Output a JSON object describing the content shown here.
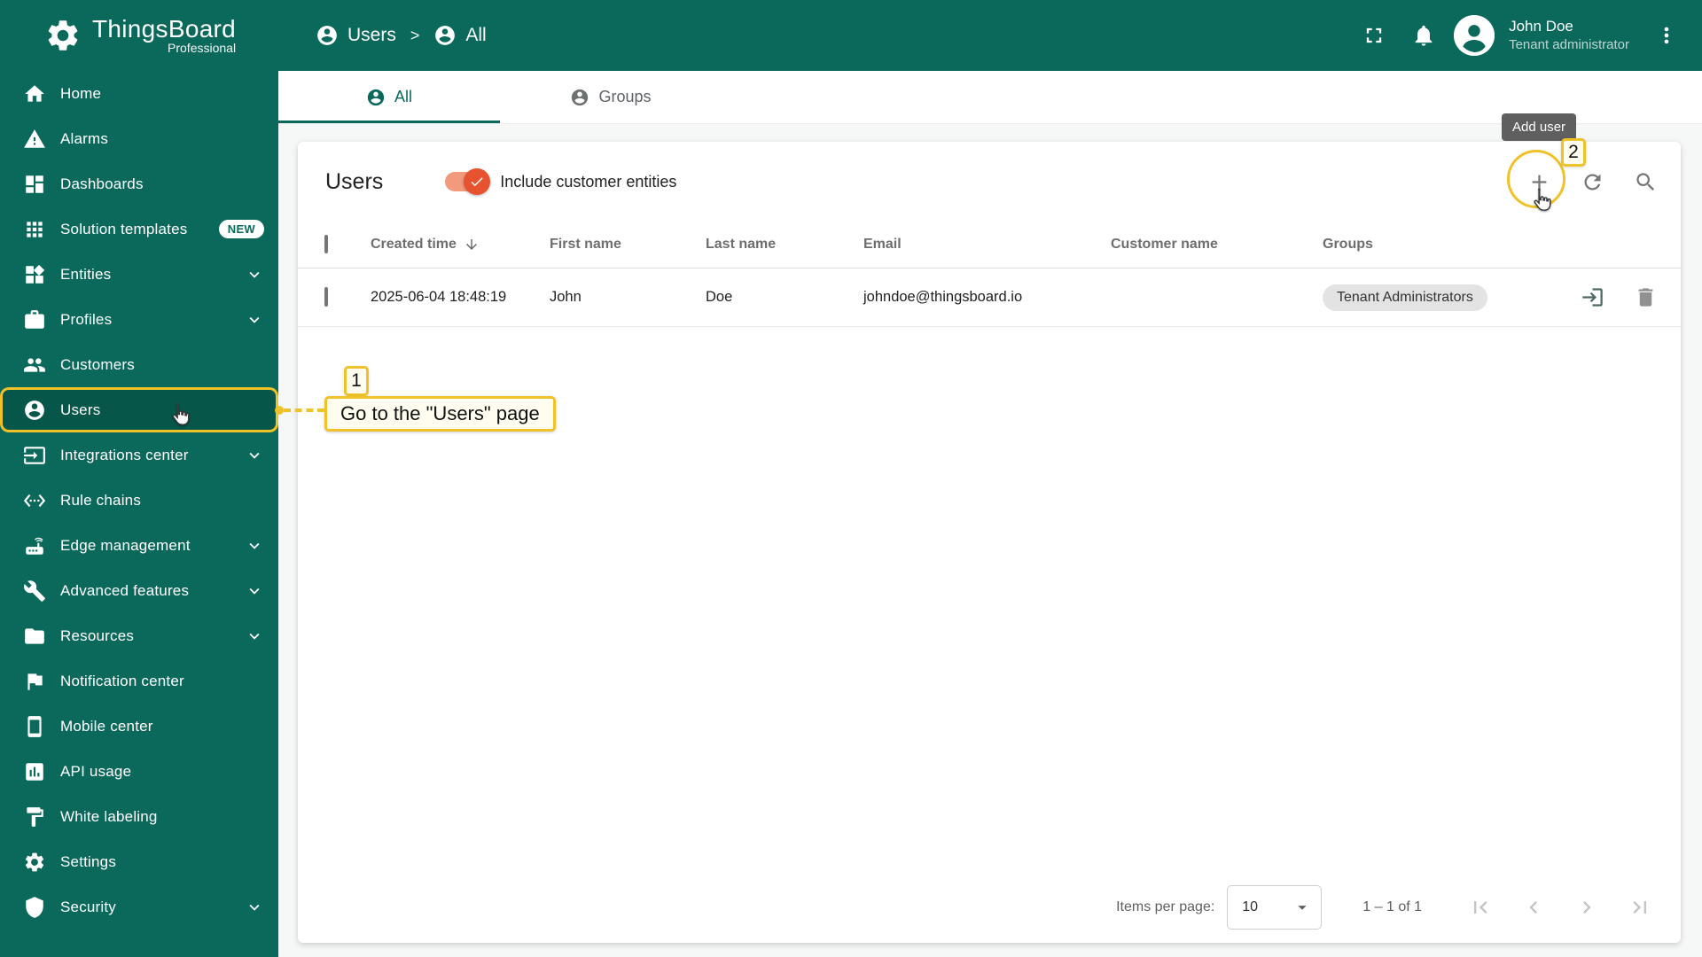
{
  "brand": {
    "name": "ThingsBoard",
    "edition": "Professional"
  },
  "header": {
    "breadcrumb": [
      {
        "label": "Users"
      },
      {
        "label": "All"
      }
    ],
    "separator": ">",
    "user_name": "John Doe",
    "user_role": "Tenant administrator"
  },
  "sidebar": {
    "items": [
      {
        "id": "home",
        "label": "Home",
        "icon": "home"
      },
      {
        "id": "alarms",
        "label": "Alarms",
        "icon": "alarm"
      },
      {
        "id": "dashboards",
        "label": "Dashboards",
        "icon": "dashboard"
      },
      {
        "id": "solution-templates",
        "label": "Solution templates",
        "icon": "apps",
        "badge": "NEW"
      },
      {
        "id": "entities",
        "label": "Entities",
        "icon": "entities",
        "expandable": true
      },
      {
        "id": "profiles",
        "label": "Profiles",
        "icon": "profiles",
        "expandable": true
      },
      {
        "id": "customers",
        "label": "Customers",
        "icon": "customers"
      },
      {
        "id": "users",
        "label": "Users",
        "icon": "user",
        "selected": true
      },
      {
        "id": "integrations-center",
        "label": "Integrations center",
        "icon": "integration",
        "expandable": true
      },
      {
        "id": "rule-chains",
        "label": "Rule chains",
        "icon": "rulechain"
      },
      {
        "id": "edge-management",
        "label": "Edge management",
        "icon": "edge",
        "expandable": true
      },
      {
        "id": "advanced-features",
        "label": "Advanced features",
        "icon": "tools",
        "expandable": true
      },
      {
        "id": "resources",
        "label": "Resources",
        "icon": "folder",
        "expandable": true
      },
      {
        "id": "notification-center",
        "label": "Notification center",
        "icon": "flag"
      },
      {
        "id": "mobile-center",
        "label": "Mobile center",
        "icon": "phone"
      },
      {
        "id": "api-usage",
        "label": "API usage",
        "icon": "chart"
      },
      {
        "id": "white-labeling",
        "label": "White labeling",
        "icon": "paint"
      },
      {
        "id": "settings",
        "label": "Settings",
        "icon": "gear"
      },
      {
        "id": "security",
        "label": "Security",
        "icon": "shield",
        "expandable": true
      }
    ]
  },
  "tabs": [
    {
      "id": "all",
      "label": "All",
      "active": true
    },
    {
      "id": "groups",
      "label": "Groups",
      "active": false
    }
  ],
  "users_page": {
    "title": "Users",
    "include_toggle_label": "Include customer entities",
    "toggle_on": true,
    "add_tooltip": "Add user",
    "table": {
      "columns": [
        "Created time",
        "First name",
        "Last name",
        "Email",
        "Customer name",
        "Groups"
      ],
      "rows": [
        {
          "created_time": "2025-06-04 18:48:19",
          "first_name": "John",
          "last_name": "Doe",
          "email": "johndoe@thingsboard.io",
          "customer_name": "",
          "group": "Tenant Administrators"
        }
      ]
    },
    "pagination": {
      "items_per_page_label": "Items per page:",
      "items_per_page_value": "10",
      "range_label": "1 – 1 of 1"
    }
  },
  "annotations": {
    "step1_number": "1",
    "step1_text": "Go to the \"Users\" page",
    "step2_number": "2"
  },
  "colors": {
    "primary": "#0B695C",
    "selected_item": "#07564A",
    "annotation_yellow": "#EFC229",
    "toggle_on_orange": "#E8532F",
    "tooltip_bg": "#5F5F5F"
  }
}
